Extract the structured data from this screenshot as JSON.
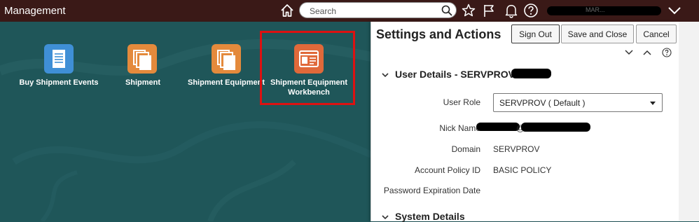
{
  "header": {
    "title": "Management",
    "search_placeholder": "Search",
    "user_name": "MAR..."
  },
  "springboard": {
    "tiles": [
      {
        "label": "Buy Shipment Events",
        "icon": "document-icon",
        "color": "#3f8fd6"
      },
      {
        "label": "Shipment",
        "icon": "stacked-pages-icon",
        "color": "#e48a3c"
      },
      {
        "label": "Shipment Equipment",
        "icon": "stacked-pages-icon",
        "color": "#e48a3c"
      },
      {
        "label_line1": "Shipment Equipment",
        "label_line2": "Workbench",
        "icon": "workbench-icon",
        "color": "#e0693a"
      }
    ]
  },
  "panel": {
    "title": "Settings and Actions",
    "buttons": {
      "sign_out": "Sign Out",
      "save_close": "Save and Close",
      "cancel": "Cancel"
    },
    "user_details": {
      "header": "User Details - SERVPROV",
      "user_role_label": "User Role",
      "user_role_value": "SERVPROV ( Default )",
      "nick_name_label": "Nick Name",
      "nick_name_at": "@",
      "domain_label": "Domain",
      "domain_value": "SERVPROV",
      "policy_label": "Account Policy ID",
      "policy_value": "BASIC POLICY",
      "password_label": "Password Expiration Date"
    },
    "system_details": {
      "header": "System Details"
    }
  },
  "colors": {
    "topbar": "#3a1917",
    "background": "#1f5659",
    "highlight": "#dd1111"
  }
}
